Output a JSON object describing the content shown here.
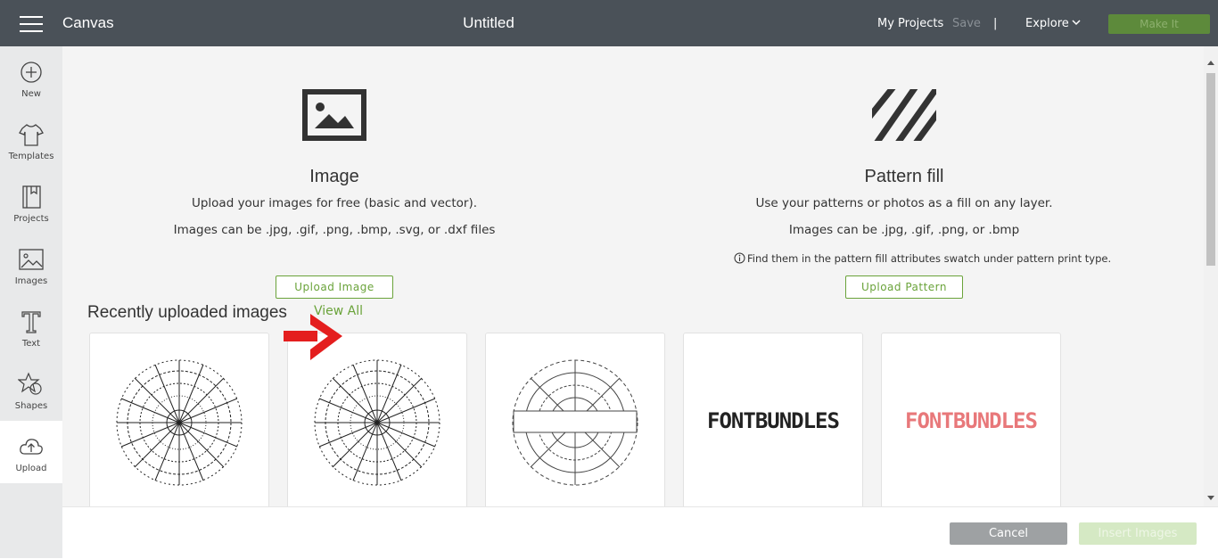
{
  "header": {
    "app_title": "Canvas",
    "doc_title": "Untitled",
    "my_projects": "My Projects",
    "save": "Save",
    "separator": "|",
    "explore": "Explore",
    "make_it": "Make It"
  },
  "sidebar": {
    "items": [
      {
        "label": "New",
        "icon": "plus-circle-icon"
      },
      {
        "label": "Templates",
        "icon": "shirt-icon"
      },
      {
        "label": "Projects",
        "icon": "notebook-icon"
      },
      {
        "label": "Images",
        "icon": "image-icon"
      },
      {
        "label": "Text",
        "icon": "text-icon"
      },
      {
        "label": "Shapes",
        "icon": "shapes-icon"
      },
      {
        "label": "Upload",
        "icon": "cloud-upload-icon",
        "active": true
      }
    ]
  },
  "image_section": {
    "title": "Image",
    "line1": "Upload your images for free (basic and vector).",
    "line2": "Images can be .jpg, .gif, .png, .bmp, .svg, or .dxf files",
    "button": "Upload Image"
  },
  "pattern_section": {
    "title": "Pattern fill",
    "line1": "Use your patterns or photos as a fill on any layer.",
    "line2": "Images can be .jpg, .gif, .png, or .bmp",
    "note": "Find them in the pattern fill attributes swatch under pattern print type.",
    "button": "Upload Pattern"
  },
  "recent": {
    "title": "Recently uploaded images",
    "view_all": "View All",
    "items": [
      {
        "kind": "mandala"
      },
      {
        "kind": "mandala"
      },
      {
        "kind": "split-mandala"
      },
      {
        "kind": "text",
        "text": "FONTBUNDLES",
        "color": "#222222"
      },
      {
        "kind": "text",
        "text": "FONTBUNDLES",
        "color": "#e8787a"
      }
    ]
  },
  "footer": {
    "cancel": "Cancel",
    "insert": "Insert Images"
  },
  "colors": {
    "accent": "#6aa33a",
    "topbar": "#4a5158",
    "annotation_arrow": "#e41e1e"
  }
}
